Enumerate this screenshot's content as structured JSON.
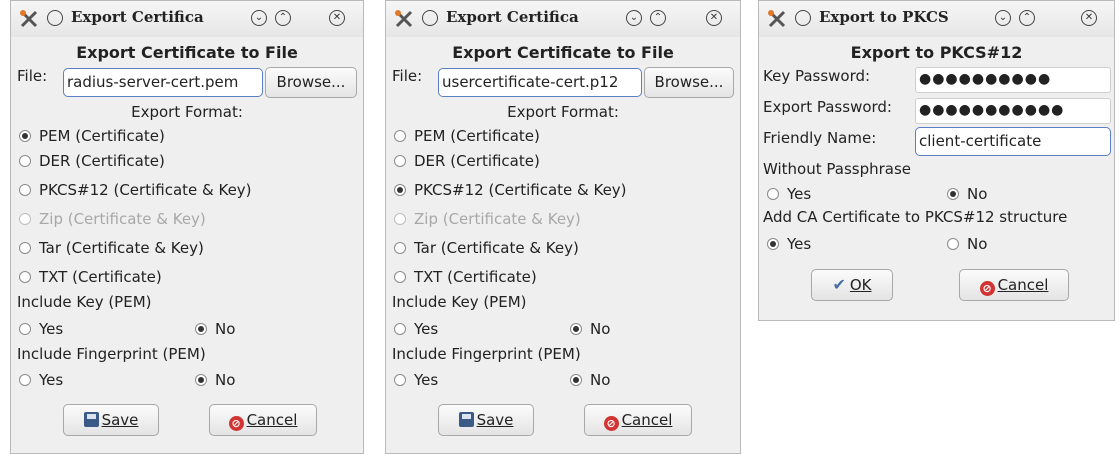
{
  "dialog1": {
    "title": "Export Certifica",
    "heading": "Export Certificate to File",
    "file_label": "File:",
    "file_value": "radius-server-cert.pem",
    "browse_label": "Browse...",
    "format_label": "Export Format:",
    "formats": [
      {
        "label": "PEM (Certificate)",
        "selected": true,
        "enabled": true
      },
      {
        "label": "DER (Certificate)",
        "selected": false,
        "enabled": true
      },
      {
        "label": "PKCS#12 (Certificate & Key)",
        "selected": false,
        "enabled": true
      },
      {
        "label": "Zip (Certificate & Key)",
        "selected": false,
        "enabled": false
      },
      {
        "label": "Tar (Certificate & Key)",
        "selected": false,
        "enabled": true
      },
      {
        "label": "TXT (Certificate)",
        "selected": false,
        "enabled": true
      }
    ],
    "include_key_label": "Include Key (PEM)",
    "include_fingerprint_label": "Include Fingerprint (PEM)",
    "yes_label": "Yes",
    "no_label": "No",
    "save_label": "Save",
    "cancel_label": "Cancel"
  },
  "dialog2": {
    "title": "Export Certifica",
    "heading": "Export Certificate to File",
    "file_label": "File:",
    "file_value": "usercertificate-cert.p12",
    "browse_label": "Browse...",
    "format_label": "Export Format:",
    "formats": [
      {
        "label": "PEM (Certificate)",
        "selected": false,
        "enabled": true
      },
      {
        "label": "DER (Certificate)",
        "selected": false,
        "enabled": true
      },
      {
        "label": "PKCS#12 (Certificate & Key)",
        "selected": true,
        "enabled": true
      },
      {
        "label": "Zip (Certificate & Key)",
        "selected": false,
        "enabled": false
      },
      {
        "label": "Tar (Certificate & Key)",
        "selected": false,
        "enabled": true
      },
      {
        "label": "TXT (Certificate)",
        "selected": false,
        "enabled": true
      }
    ],
    "include_key_label": "Include Key (PEM)",
    "include_fingerprint_label": "Include Fingerprint (PEM)",
    "yes_label": "Yes",
    "no_label": "No",
    "save_label": "Save",
    "cancel_label": "Cancel"
  },
  "dialog3": {
    "title": "Export to PKCS",
    "heading": "Export to PKCS#12",
    "key_password_label": "Key Password:",
    "key_password_value": "●●●●●●●●●●",
    "export_password_label": "Export Password:",
    "export_password_value": "●●●●●●●●●●●",
    "friendly_name_label": "Friendly Name:",
    "friendly_name_value": "client-certificate",
    "without_passphrase_label": "Without Passphrase",
    "add_ca_label": "Add CA Certificate to PKCS#12 structure",
    "yes_label": "Yes",
    "no_label": "No",
    "without_passphrase_selected": "No",
    "add_ca_selected": "Yes",
    "ok_label": "OK",
    "cancel_label": "Cancel"
  },
  "icons": {
    "app": "tools-icon",
    "minimize": "circle-icon",
    "shade": "chevron-down-icon",
    "maximize": "chevron-up-icon",
    "close": "close-icon"
  }
}
